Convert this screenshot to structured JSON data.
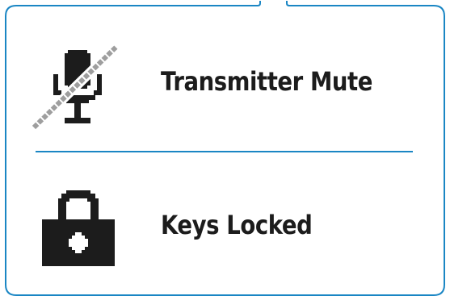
{
  "colors": {
    "frame": "#1a86c4",
    "divider": "#1a86c4",
    "icon": "#1c1c1c",
    "strike": "#9e9e9e",
    "text": "#1c1c1c"
  },
  "items": [
    {
      "label": "Transmitter Mute",
      "icon": "microphone-muted-icon"
    },
    {
      "label": "Keys Locked",
      "icon": "padlock-icon"
    }
  ]
}
